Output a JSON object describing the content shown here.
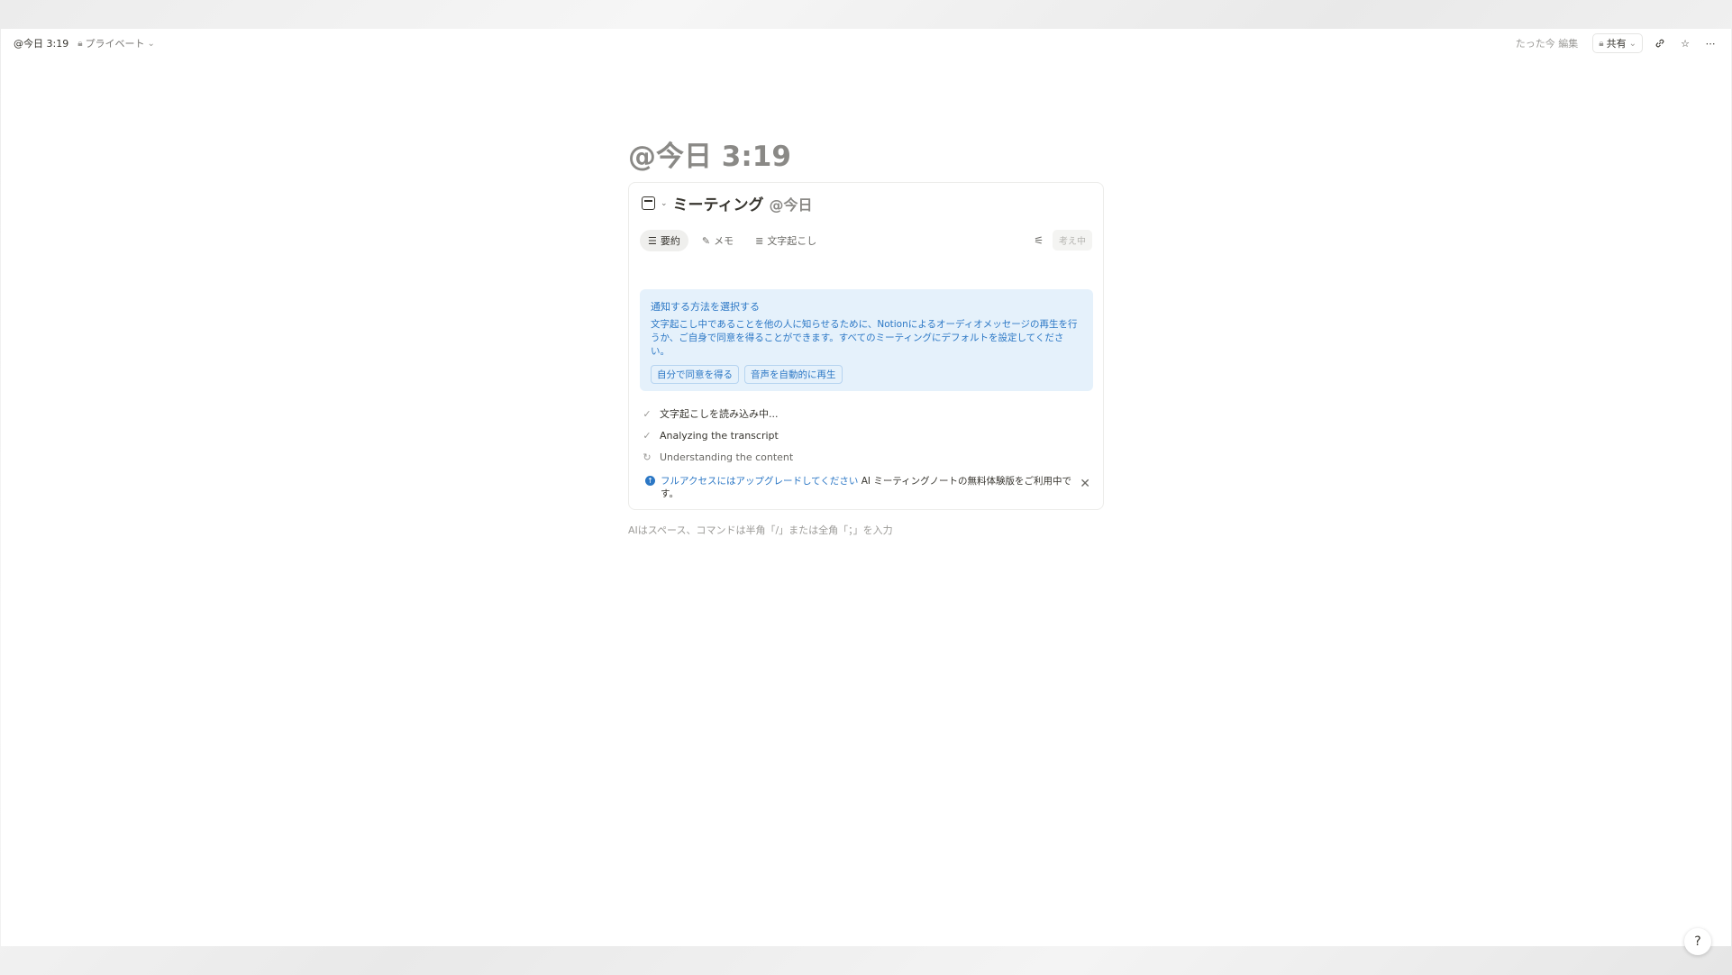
{
  "topbar": {
    "breadcrumb": "@今日 3:19",
    "privacy": "プライベート",
    "edited": "たった今 編集",
    "share": "共有"
  },
  "page": {
    "title": "@今日 3:19"
  },
  "meeting": {
    "title": "ミーティング",
    "date": "@今日",
    "tabs": [
      "要約",
      "メモ",
      "文字起こし"
    ],
    "status": "考え中",
    "notice": {
      "title": "通知する方法を選択する",
      "body": "文字起こし中であることを他の人に知らせるために、Notionによるオーディオメッセージの再生を行うか、ご自身で同意を得ることができます。すべてのミーティングにデフォルトを設定してください。",
      "actions": [
        "自分で同意を得る",
        "音声を自動的に再生"
      ]
    },
    "steps": [
      {
        "label": "文字起こしを読み込み中...",
        "state": "done"
      },
      {
        "label": "Analyzing the transcript",
        "state": "done"
      },
      {
        "label": "Understanding the content",
        "state": "in-progress"
      }
    ],
    "upgrade": {
      "link": "フルアクセスにはアップグレードしてください",
      "text": " AI ミーティングノートの無料体験版をご利用中です。"
    }
  },
  "editor": {
    "hint": "AIはスペース、コマンドは半角「/」または全角「；」を入力"
  },
  "help": {
    "label": "?"
  }
}
